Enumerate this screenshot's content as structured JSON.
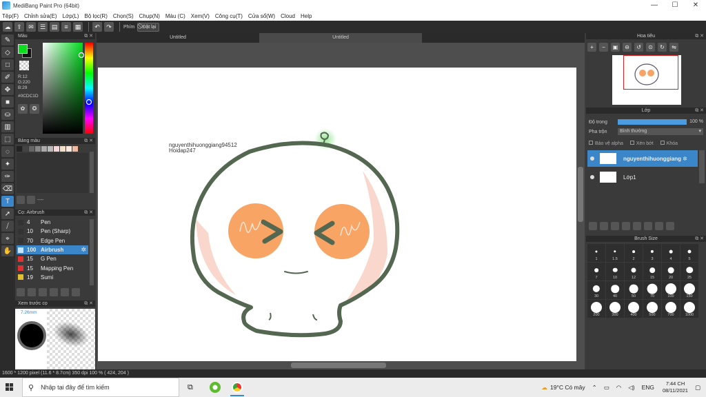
{
  "window": {
    "title": "MediBang Paint Pro (64bit)",
    "minimize": "—",
    "maximize": "☐",
    "close": "✕"
  },
  "menu": [
    "Tệp(F)",
    "Chỉnh sửa(E)",
    "Lớp(L)",
    "Bộ lọc(R)",
    "Chọn(S)",
    "Chụp(N)",
    "Màu (C)",
    "Xem(V)",
    "Công cụ(T)",
    "Cửa sổ(W)",
    "Cloud",
    "Help"
  ],
  "toolbar": {
    "shortcut_label": "Phím",
    "reset_label": "Đặt lại"
  },
  "color_panel": {
    "title": "Màu",
    "r": "R:12",
    "g": "G:220",
    "b": "B:29",
    "hex": "#0CDC1D",
    "fg_color": "#0cdc1d"
  },
  "palette_panel": {
    "title": "Bảng màu",
    "swatches": [
      "#222222",
      "#444444",
      "#666666",
      "#888888",
      "#aaaaaa",
      "#bbbbbb",
      "#f5d5d5",
      "#f4e0c8",
      "#fbe8e0",
      "#f2b8a0"
    ],
    "footer_text": "----"
  },
  "brush_panel": {
    "title": "Cọ: Airbrush",
    "brushes": [
      {
        "size": "4",
        "name": "Pen",
        "color": "#333333"
      },
      {
        "size": "10",
        "name": "Pen (Sharp)",
        "color": "#333333"
      },
      {
        "size": "70",
        "name": "Edge Pen",
        "color": "#333333"
      },
      {
        "size": "100",
        "name": "Airbrush",
        "color": "#c9e6ff",
        "selected": true
      },
      {
        "size": "15",
        "name": "G Pen",
        "color": "#e03030"
      },
      {
        "size": "15",
        "name": "Mapping Pen",
        "color": "#e03030"
      },
      {
        "size": "19",
        "name": "Sumi",
        "color": "#e0c030"
      }
    ]
  },
  "preview_panel": {
    "title": "Xem trước cọ",
    "size_mm": "7.26mm"
  },
  "tabs": [
    "Untitled",
    "Untitled"
  ],
  "canvas": {
    "watermark_line1": "nguyenthihuonggiang94512",
    "watermark_line2": "Hoidap247"
  },
  "navigator": {
    "title": "Hoa tiêu"
  },
  "layer_panel": {
    "title": "Lớp",
    "opacity_label": "Độ trong",
    "opacity_value": "100 %",
    "opacity": 1.0,
    "blend_label": "Pha trộn",
    "blend_value": "Bình thường",
    "protect_alpha": "Bảo vệ alpha",
    "clipping": "Xén bớt",
    "lock": "Khóa",
    "layers": [
      {
        "name": "nguyenthihuonggiang",
        "selected": true
      },
      {
        "name": "Lớp1",
        "selected": false
      }
    ]
  },
  "brush_size_panel": {
    "title": "Brush Size",
    "sizes": [
      "1",
      "1.5",
      "2",
      "3",
      "4",
      "5",
      "7",
      "10",
      "12",
      "15",
      "20",
      "25",
      "30",
      "40",
      "50",
      "70",
      "100",
      "150",
      "200",
      "300",
      "400",
      "500",
      "700",
      "1000"
    ]
  },
  "status": {
    "text": "1600 * 1200 pixel   (11.6 * 8.7cm)   350 dpi   100 %   ( 424, 204 )"
  },
  "taskbar": {
    "search_placeholder": "Nhập tại đây để tìm kiếm",
    "weather": "19°C  Có mây",
    "language": "ENG",
    "time": "7:44 CH",
    "date": "08/11/2021"
  }
}
